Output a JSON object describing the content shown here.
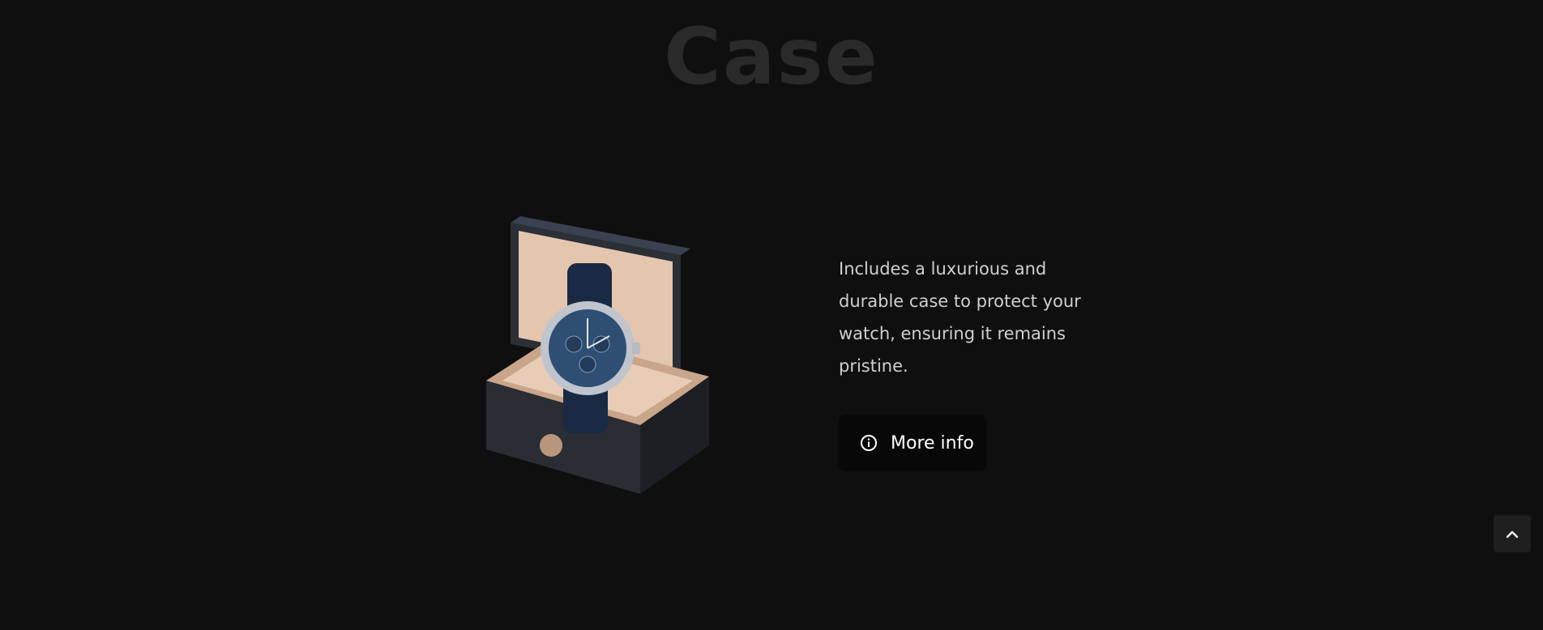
{
  "section": {
    "title": "Case"
  },
  "feature": {
    "description": "Includes a luxurious and durable case to protect your watch, ensuring it remains pristine.",
    "button_label": "More info",
    "button_icon": "info-circle-icon"
  },
  "scroll_top": {
    "icon": "chevron-up-icon"
  },
  "colors": {
    "background": "#0f0f0f",
    "title": "#2a2a2a",
    "text": "#cfcfcf",
    "button_bg": "#080808"
  }
}
